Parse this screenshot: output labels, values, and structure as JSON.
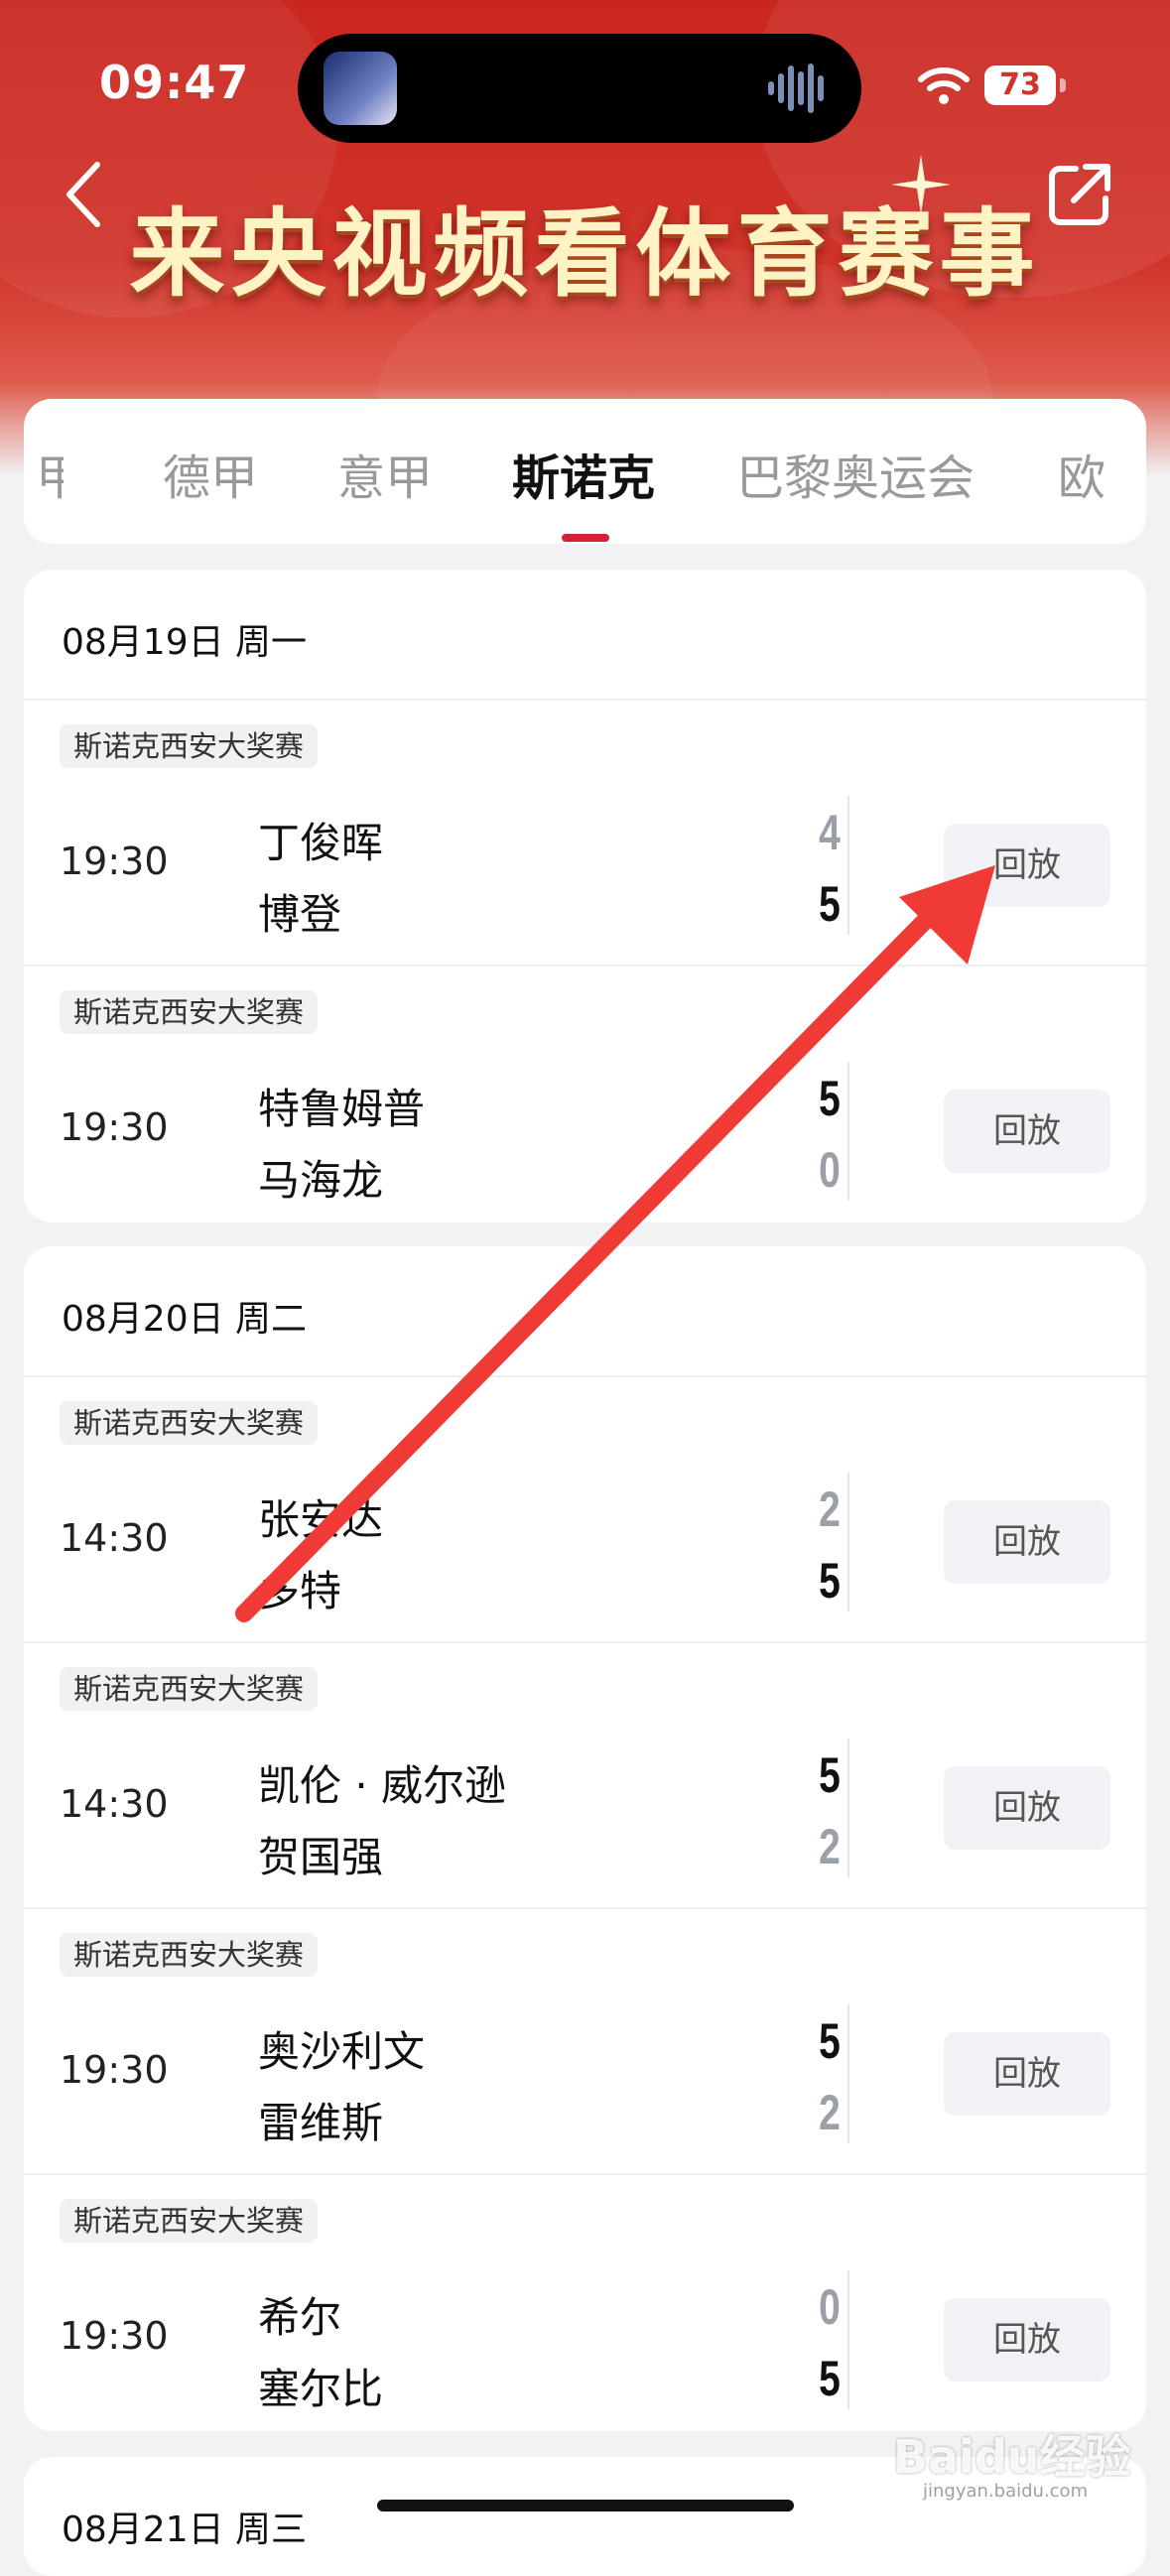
{
  "status_bar": {
    "time": "09:47",
    "battery": "73"
  },
  "banner": {
    "title": "来央视频看体育赛事"
  },
  "tabs": [
    {
      "label": "甲"
    },
    {
      "label": "德甲"
    },
    {
      "label": "意甲"
    },
    {
      "label": "斯诺克"
    },
    {
      "label": "巴黎奥运会"
    },
    {
      "label": "欧"
    }
  ],
  "sections": [
    {
      "date": "08月19日 周一",
      "matches": [
        {
          "league": "斯诺克西安大奖赛",
          "time": "19:30",
          "player1": "丁俊晖",
          "score1": "4",
          "player2": "博登",
          "score2": "5",
          "action": "回放"
        },
        {
          "league": "斯诺克西安大奖赛",
          "time": "19:30",
          "player1": "特鲁姆普",
          "score1": "5",
          "player2": "马海龙",
          "score2": "0",
          "action": "回放"
        }
      ]
    },
    {
      "date": "08月20日 周二",
      "matches": [
        {
          "league": "斯诺克西安大奖赛",
          "time": "14:30",
          "player1": "张安达",
          "score1": "2",
          "player2": "多特",
          "score2": "5",
          "action": "回放"
        },
        {
          "league": "斯诺克西安大奖赛",
          "time": "14:30",
          "player1": "凯伦 · 威尔逊",
          "score1": "5",
          "player2": "贺国强",
          "score2": "2",
          "action": "回放"
        },
        {
          "league": "斯诺克西安大奖赛",
          "time": "19:30",
          "player1": "奥沙利文",
          "score1": "5",
          "player2": "雷维斯",
          "score2": "2",
          "action": "回放"
        },
        {
          "league": "斯诺克西安大奖赛",
          "time": "19:30",
          "player1": "希尔",
          "score1": "0",
          "player2": "塞尔比",
          "score2": "5",
          "action": "回放"
        }
      ]
    },
    {
      "date": "08月21日 周三"
    }
  ],
  "watermark": {
    "text": "Baidu经验",
    "sub": "jingyan.baidu.com"
  },
  "colors": {
    "header_red": "#c9261f",
    "tab_indicator": "#d6203a",
    "arrow": "#f03a36"
  }
}
